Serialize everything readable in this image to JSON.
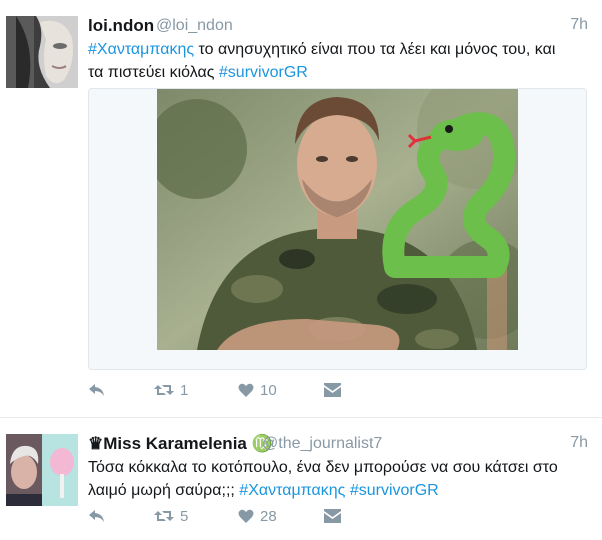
{
  "tweet1": {
    "name": "loi.ndon",
    "handle": "@loi_ndon",
    "time": "7h",
    "text": {
      "line1_tag": "#Χανταμπακης",
      "line1_rest": " το ανησυχητικό είναι που τα λέει και μόνος του, και",
      "line2_start": "τα πιστεύει κιόλας ",
      "line2_tag": "#survivorGR"
    },
    "actions": {
      "reply_icon": "reply-icon",
      "retweet_icon": "retweet-icon",
      "retweet_count": "1",
      "like_icon": "heart-icon",
      "like_count": "10",
      "dm_icon": "envelope-icon"
    }
  },
  "tweet2": {
    "name": "♛Miss Karamelenia ♍",
    "handle": "@the_journalist7",
    "time": "7h",
    "text": {
      "line1": "Τόσα κόκκαλα το κοτόπουλο, ένα δεν μπορούσε να σου κάτσει στο",
      "line2_start": "λαιμό μωρή σαύρα;;; ",
      "line2_tag1": "#Χανταμπακης",
      "line2_space": " ",
      "line2_tag2": "#survivorGR"
    },
    "actions": {
      "reply_icon": "reply-icon",
      "retweet_icon": "retweet-icon",
      "retweet_count": "5",
      "like_icon": "heart-icon",
      "like_count": "28",
      "dm_icon": "envelope-icon"
    }
  },
  "colors": {
    "link": "#1b95e0",
    "muted": "#8899a6",
    "text": "#14171a",
    "snake": "#6bbf4a",
    "camo": "#4f5a3a"
  }
}
